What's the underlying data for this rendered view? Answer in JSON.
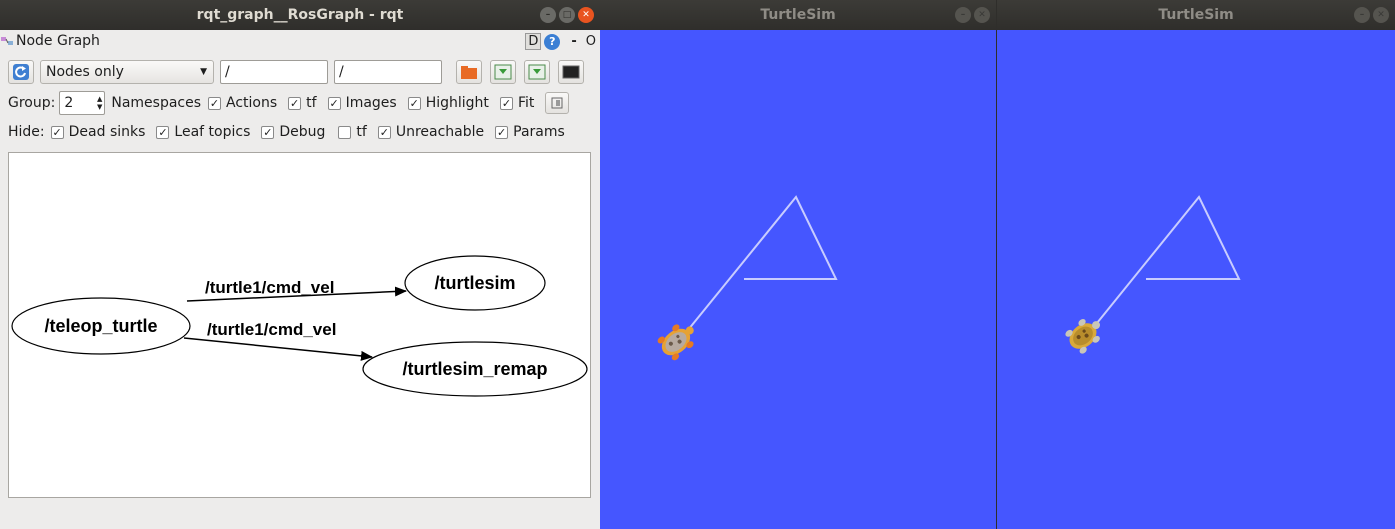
{
  "rqt": {
    "title": "rqt_graph__RosGraph - rqt",
    "plugin_title": "Node Graph",
    "plugin_d": "D",
    "plugin_help": "?",
    "plugin_dash": "-",
    "plugin_o": "O",
    "mode_select": "Nodes only",
    "filter1": "/",
    "filter2": "/",
    "group_label": "Group:",
    "group_value": "2",
    "options": [
      {
        "label": "Namespaces",
        "checked": false
      },
      {
        "label": "Actions",
        "checked": true
      },
      {
        "label": "tf",
        "checked": true
      },
      {
        "label": "Images",
        "checked": true
      },
      {
        "label": "Highlight",
        "checked": true
      },
      {
        "label": "Fit",
        "checked": true
      }
    ],
    "hide_label": "Hide:",
    "hide_options": [
      {
        "label": "Dead sinks",
        "checked": true
      },
      {
        "label": "Leaf topics",
        "checked": true
      },
      {
        "label": "Debug",
        "checked": true
      },
      {
        "label": "tf",
        "checked": false
      },
      {
        "label": "Unreachable",
        "checked": true
      },
      {
        "label": "Params",
        "checked": true
      }
    ],
    "graph": {
      "nodes": [
        "/teleop_turtle",
        "/turtlesim",
        "/turtlesim_remap"
      ],
      "edges": [
        {
          "from": "/teleop_turtle",
          "to": "/turtlesim",
          "label": "/turtle1/cmd_vel"
        },
        {
          "from": "/teleop_turtle",
          "to": "/turtlesim_remap",
          "label": "/turtle1/cmd_vel"
        }
      ]
    }
  },
  "turtlesim1": {
    "title": "TurtleSim"
  },
  "turtlesim2": {
    "title": "TurtleSim"
  },
  "colors": {
    "turtlesim_bg": "#4556ff",
    "close_button": "#e95420",
    "titlebar": "#2f2e2b"
  }
}
